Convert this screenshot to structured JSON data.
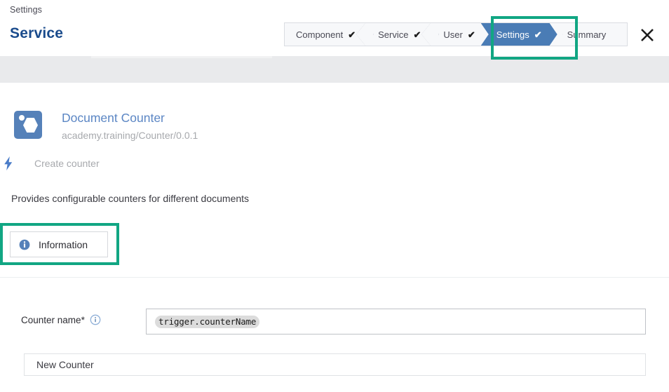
{
  "header": {
    "breadcrumb": "Settings",
    "title": "Service",
    "close_label": "close-icon"
  },
  "wizard": {
    "steps": [
      {
        "label": "Component",
        "check": "✔",
        "state": "done"
      },
      {
        "label": "Service",
        "check": "✔",
        "state": "done"
      },
      {
        "label": "User",
        "check": "✔",
        "state": "done"
      },
      {
        "label": "Settings",
        "check": "✔",
        "state": "active"
      },
      {
        "label": "Summary",
        "check": "",
        "state": "upcoming"
      }
    ],
    "highlight_color": "#11a683",
    "active_color": "#4a7cb5"
  },
  "service": {
    "icon_name": "document-counter-app-icon",
    "name": "Document Counter",
    "identifier": "academy.training/Counter/0.0.1",
    "operation_icon": "lightning-bolt-icon",
    "operation": "Create counter",
    "description": "Provides configurable counters for different documents"
  },
  "tabs": {
    "items": [
      {
        "label": "Information",
        "icon": "info-circle-icon",
        "active": true
      }
    ]
  },
  "form": {
    "fields": [
      {
        "label": "Counter name",
        "required_marker": "*",
        "info_icon": "info-circle-outline-icon",
        "token_value": "trigger.counterName",
        "placeholder": ""
      }
    ],
    "secondary_input": {
      "value": "New Counter",
      "placeholder": ""
    }
  },
  "colors": {
    "highlight": "#11a683",
    "accent_blue": "#4a7cb5",
    "title_blue": "#1a4b8c",
    "link_blue": "#5b86c4",
    "muted": "#a7a9ad",
    "band_gray": "#e9eaec"
  }
}
